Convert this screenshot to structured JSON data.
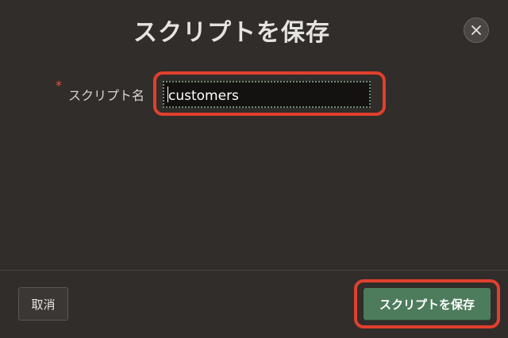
{
  "dialog": {
    "title": "スクリプトを保存",
    "close_icon": "close-icon"
  },
  "form": {
    "required_mark": "*",
    "script_name_label": "スクリプト名",
    "script_name_value": "customers"
  },
  "footer": {
    "cancel_label": "取消",
    "save_label": "スクリプトを保存"
  },
  "colors": {
    "background": "#312d2a",
    "save_button": "#4d7c5c",
    "highlight": "#e0402e",
    "required": "#e0524a"
  }
}
